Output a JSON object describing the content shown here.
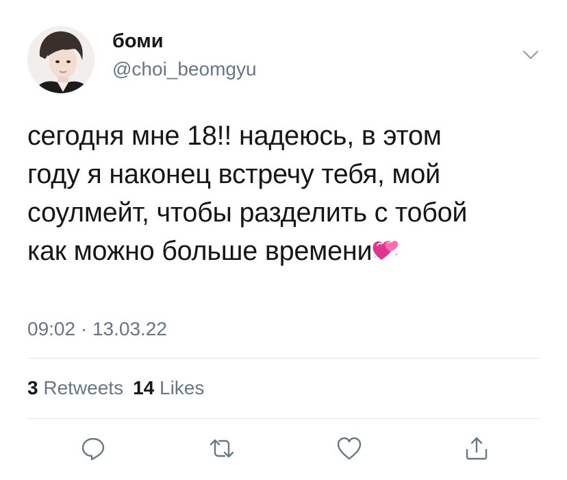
{
  "tweet": {
    "author": {
      "display_name": "боми",
      "handle": "@choi_beomgyu"
    },
    "body_lines": [
      "сегодня мне 18!! надеюсь, в этом",
      "году я наконец встречу тебя, мой",
      "соулмейт, чтобы разделить с тобой",
      "как можно больше времени"
    ],
    "emoji": "two-hearts-emoji",
    "timestamp": "09:02 · 13.03.22",
    "stats": {
      "retweets_count": "3",
      "retweets_label": "Retweets",
      "likes_count": "14",
      "likes_label": "Likes"
    },
    "actions": [
      "reply-icon",
      "retweet-icon",
      "like-icon",
      "share-icon"
    ]
  },
  "colors": {
    "text": "#14171a",
    "secondary": "#657786",
    "divider": "#e1e8ed",
    "icon": "#657786"
  }
}
